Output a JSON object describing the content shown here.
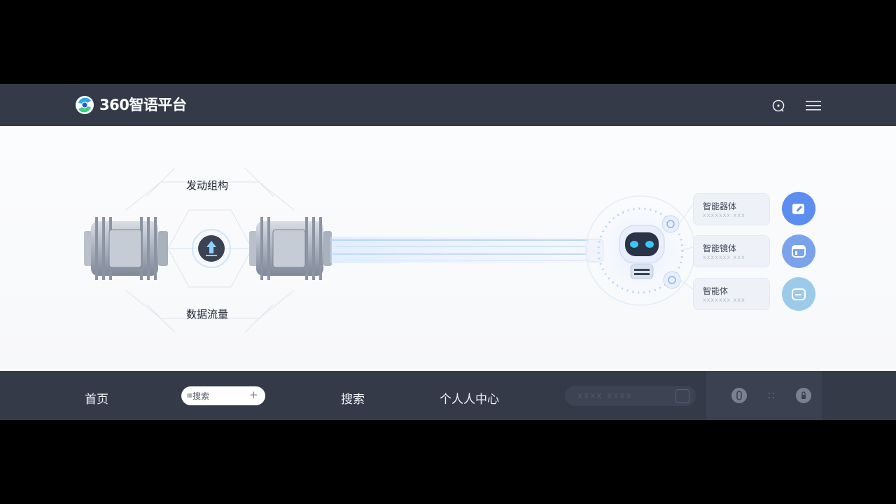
{
  "header": {
    "brand": "360智语平台",
    "logo_icon": "swirl-logo-icon",
    "chat_icon": "chat-bubble-icon",
    "menu_icon": "hamburger-menu-icon"
  },
  "diagram": {
    "top_label": "发动组构",
    "bottom_label": "数据流量",
    "center_icon": "upload-arrow-icon",
    "robot_icon": "robot-icon"
  },
  "agents": [
    {
      "title": "智能器体",
      "subtitle": "xxxxxxx xxx",
      "icon": "edit-note-icon",
      "color": "#5b8ef0"
    },
    {
      "title": "智能镜体",
      "subtitle": "xxxxxxx xxx",
      "icon": "browser-window-icon",
      "color": "#7aa3ea"
    },
    {
      "title": "智能体",
      "subtitle": "xxxxxxx xxx",
      "icon": "folder-icon",
      "color": "#9ccbea"
    }
  ],
  "bottom_nav": {
    "home": "首页",
    "search_placeholder": "搜索",
    "search": "搜索",
    "profile": "个人人中心",
    "ghost_input": "xxxx xxxx"
  },
  "colors": {
    "bar": "#343a48",
    "accent": "#5b8ef0",
    "robot_eyes": "#39c7ff"
  }
}
